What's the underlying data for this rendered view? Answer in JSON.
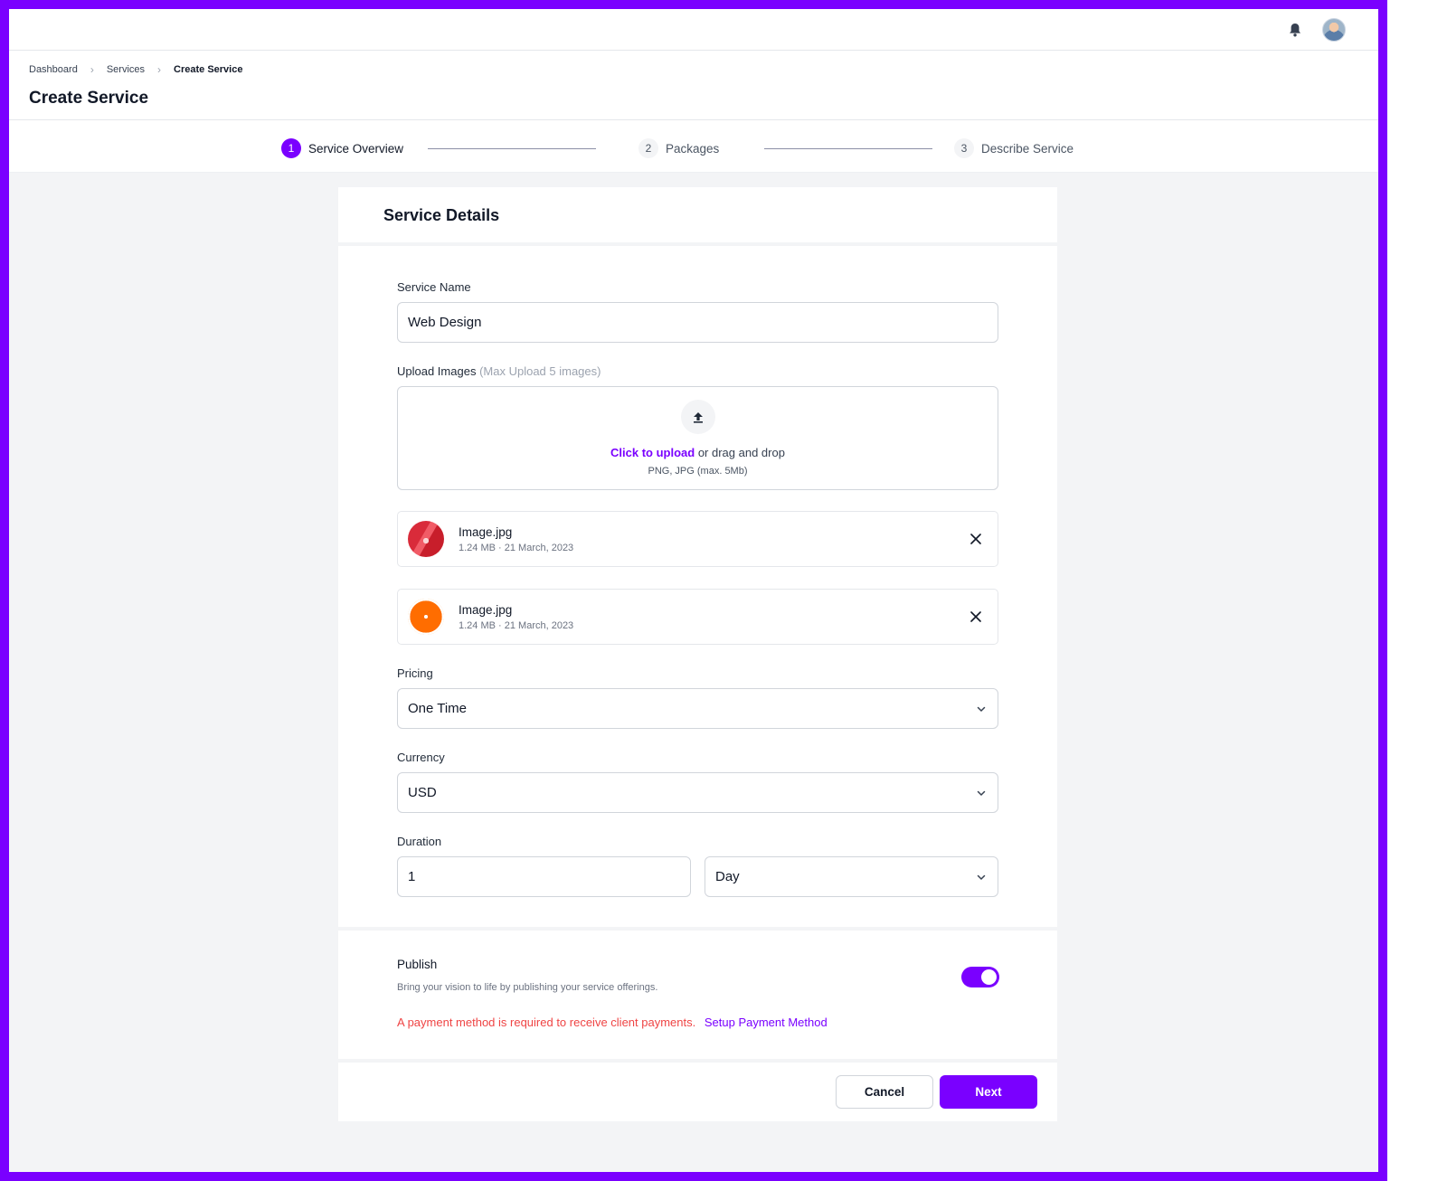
{
  "colors": {
    "accent": "#7a00ff",
    "frame": "#7a00ff",
    "warning": "#ef4444",
    "background": "#f3f4f6"
  },
  "topbar": {
    "notification_icon": "bell-icon",
    "avatar_icon": "user-avatar"
  },
  "breadcrumb": [
    "Dashboard",
    "Services",
    "Create Service"
  ],
  "page_title": "Create Service",
  "stepper": [
    {
      "number": "1",
      "label": "Service Overview",
      "state": "active"
    },
    {
      "number": "2",
      "label": "Packages",
      "state": "inactive"
    },
    {
      "number": "3",
      "label": "Describe Service",
      "state": "inactive"
    }
  ],
  "form": {
    "section_title": "Service Details",
    "service_name": {
      "label": "Service Name",
      "value": "Web Design"
    },
    "upload": {
      "label": "Upload Images",
      "hint": "(Max Upload 5 images)",
      "link_text": "Click to upload",
      "text": "or drag and drop",
      "formats": "PNG, JPG  (max. 5Mb)",
      "icon": "upload-icon"
    },
    "files": [
      {
        "name": "Image.jpg",
        "meta": "1.24 MB · 21 March, 2023",
        "thumb": "red"
      },
      {
        "name": "Image.jpg",
        "meta": "1.24 MB · 21 March, 2023",
        "thumb": "orange"
      }
    ],
    "pricing": {
      "label": "Pricing",
      "value": "One Time"
    },
    "currency": {
      "label": "Currency",
      "value": "USD"
    },
    "duration": {
      "label": "Duration",
      "amount": "1",
      "unit": "Day"
    }
  },
  "publish": {
    "title": "Publish",
    "description": "Bring your vision to life by publishing your service offerings.",
    "enabled": true,
    "warning": "A payment method is required to receive client payments.",
    "link": "Setup Payment Method"
  },
  "footer": {
    "cancel": "Cancel",
    "next": "Next"
  }
}
